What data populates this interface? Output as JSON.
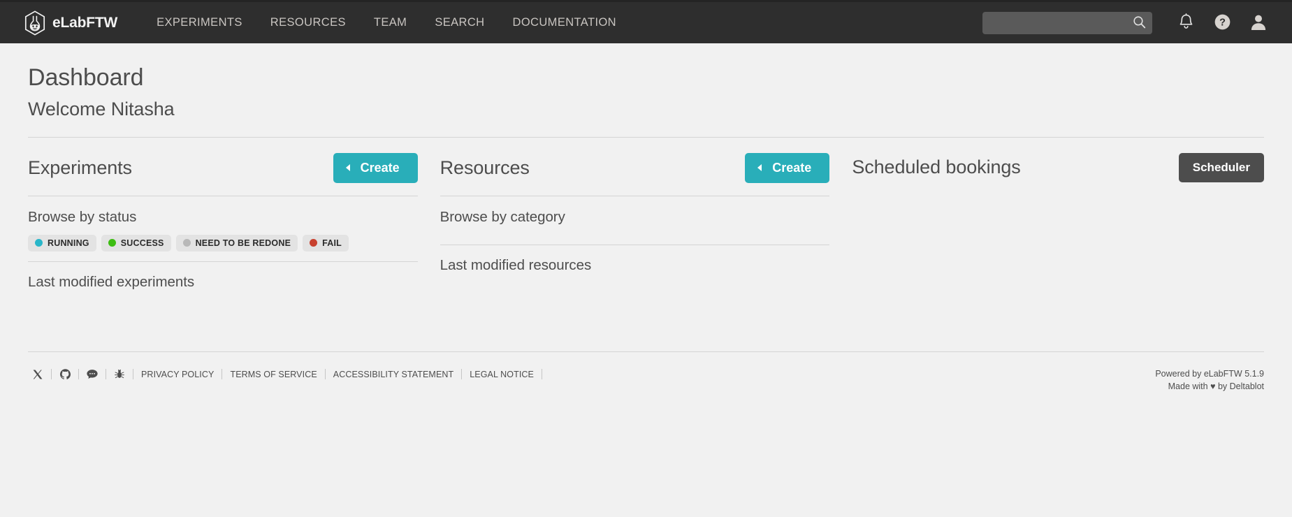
{
  "navbar": {
    "brand": "eLabFTW",
    "links": [
      {
        "label": "EXPERIMENTS"
      },
      {
        "label": "RESOURCES"
      },
      {
        "label": "TEAM"
      },
      {
        "label": "SEARCH"
      },
      {
        "label": "DOCUMENTATION"
      }
    ],
    "search": {
      "value": "",
      "placeholder": ""
    },
    "icons": {
      "search": "search-icon",
      "notifications": "bell-icon",
      "help": "question-circle-icon",
      "user": "user-icon"
    }
  },
  "page": {
    "title": "Dashboard",
    "subtitle": "Welcome Nitasha"
  },
  "columns": {
    "experiments": {
      "title": "Experiments",
      "create_label": "Create",
      "browse_title": "Browse by status",
      "statuses": [
        {
          "label": "RUNNING",
          "color": "#29b6c9"
        },
        {
          "label": "SUCCESS",
          "color": "#3dbd12"
        },
        {
          "label": "NEED TO BE REDONE",
          "color": "#b8b8b8"
        },
        {
          "label": "FAIL",
          "color": "#c8412f"
        }
      ],
      "last_modified_title": "Last modified experiments"
    },
    "resources": {
      "title": "Resources",
      "create_label": "Create",
      "browse_title": "Browse by category",
      "categories": [],
      "last_modified_title": "Last modified resources"
    },
    "bookings": {
      "title": "Scheduled bookings",
      "scheduler_label": "Scheduler"
    }
  },
  "footer": {
    "social": [
      {
        "name": "x-twitter-icon",
        "title": "X"
      },
      {
        "name": "github-icon",
        "title": "GitHub"
      },
      {
        "name": "chat-bubble-icon",
        "title": "Chat"
      },
      {
        "name": "bug-icon",
        "title": "Report a bug"
      }
    ],
    "links": [
      {
        "label": "PRIVACY POLICY"
      },
      {
        "label": "TERMS OF SERVICE"
      },
      {
        "label": "ACCESSIBILITY STATEMENT"
      },
      {
        "label": "LEGAL NOTICE"
      }
    ],
    "powered_by_prefix": "Powered by ",
    "powered_by_name": "eLabFTW",
    "version": "5.1.9",
    "made_with_prefix": "Made with ",
    "heart": "♥",
    "made_with_mid": " by ",
    "made_with_author": "Deltablot"
  },
  "theme": {
    "navbar_bg": "#2e2e2e",
    "page_bg": "#f1f1f1",
    "accent": "#29aeb9",
    "dark_button": "#4d4d4d",
    "text": "#4d4d4d",
    "rule": "#d4d4d4"
  }
}
